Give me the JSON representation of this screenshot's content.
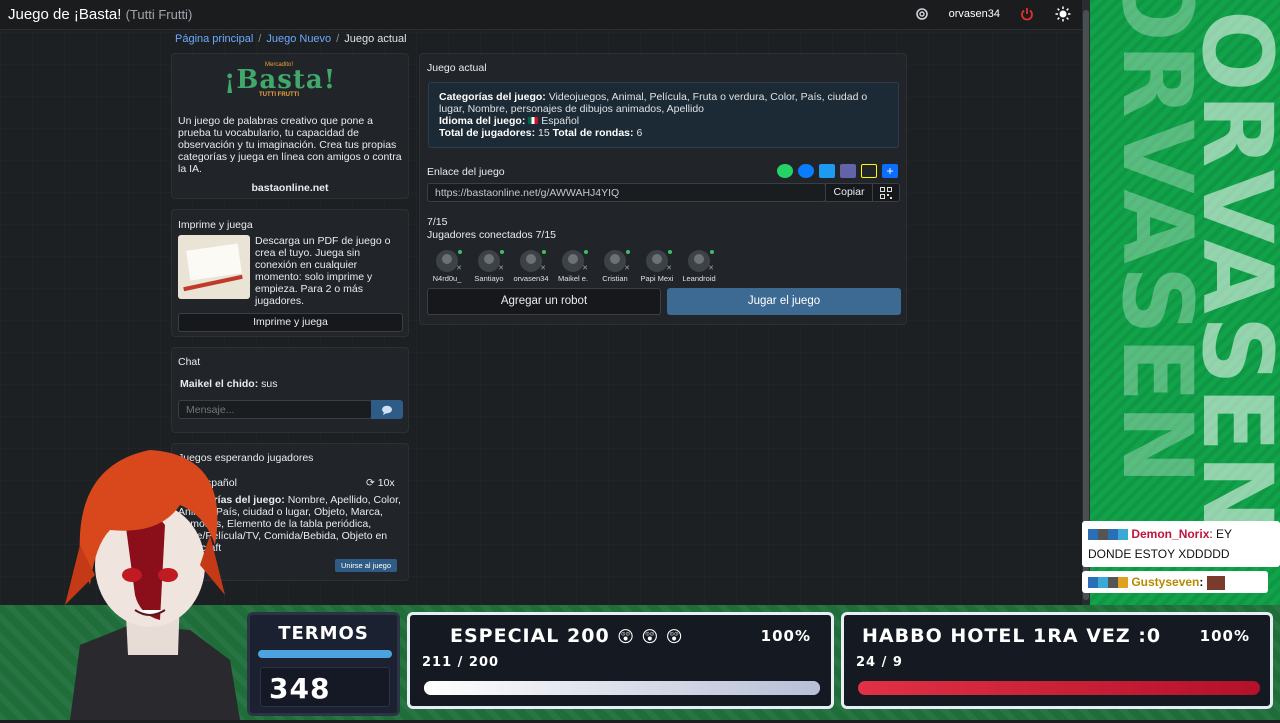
{
  "navbar": {
    "title": "Juego de ¡Basta!",
    "subtitle": "(Tutti Frutti)",
    "username": "orvasen34"
  },
  "breadcrumb": [
    "Página principal",
    "Juego Nuevo",
    "Juego actual"
  ],
  "left": {
    "logo": {
      "small": "Mercadito!",
      "big": "¡Basta!",
      "tag": "TUTTI FRUTTI"
    },
    "description": "Un juego de palabras creativo que pone a prueba tu vocabulario, tu capacidad de observación y tu imaginación. Crea tus propias categorías y juega en línea con amigos o contra la IA.",
    "site": "bastaonline.net",
    "print": {
      "title": "Imprime y juega",
      "text": "Descarga un PDF de juego o crea el tuyo. Juega sin conexión en cualquier momento: solo imprime y empieza. Para 2 o más jugadores.",
      "button": "Imprime y juega"
    },
    "chat": {
      "title": "Chat",
      "author": "Maikel el chido:",
      "message": "sus",
      "placeholder": "Mensaje..."
    },
    "waiting": {
      "title": "Juegos esperando jugadores",
      "language": "Español",
      "count": "10x",
      "categories_label": "Categorías del juego:",
      "categories": "Nombre, Apellido, Color, Animal, País, ciudad o lugar, Objeto, Marca, Famosos, Elemento de la tabla periódica, Serie/Película/TV, Comida/Bebida, Objeto en Minecraft",
      "join": "Unirse al juego"
    }
  },
  "game": {
    "title": "Juego actual",
    "categories_label": "Categorías del juego:",
    "categories": "Videojuegos, Animal, Película, Fruta o verdura, Color, País, ciudad o lugar, Nombre, personajes de dibujos animados, Apellido",
    "language_label": "Idioma del juego:",
    "language": "Español",
    "players_label": "Total de jugadores:",
    "players": "15",
    "rounds_label": "Total de rondas:",
    "rounds": "6",
    "link_label": "Enlace del juego",
    "link": "https://bastaonline.net/g/AWWAHJ4YIQ",
    "copy": "Copiar",
    "count": "7/15",
    "connected": "Jugadores conectados 7/15",
    "player_names": [
      "N4rd0u_",
      "Santiayo",
      "orvasen34",
      "Maikel e.",
      "Cristian",
      "Papi Mexi",
      "Leandroid"
    ],
    "add_robot": "Agregar un robot",
    "play": "Jugar el juego"
  },
  "stream": {
    "termos_title": "TERMOS",
    "termos_value": "348",
    "goal1_title": "ESPECIAL 200",
    "goal1_pct": "100%",
    "goal1_count": "211 / 200",
    "goal1_progress": 1.0,
    "goal2_title": "HABBO HOTEL 1RA VEZ :0",
    "goal2_pct": "100%",
    "goal2_count": "24 / 9",
    "goal2_progress": 1.0,
    "banner_text": "ORVASEN",
    "chat1_name": "Demon_Norix",
    "chat1_msg": ": EY DONDE ESTOY XDDDDD",
    "chat2_name": "Gustyseven",
    "chat2_msg": ":"
  },
  "colors": {
    "accent": "#2f5c86",
    "green_panel": "#11a34a",
    "name_red": "#c0143c"
  }
}
